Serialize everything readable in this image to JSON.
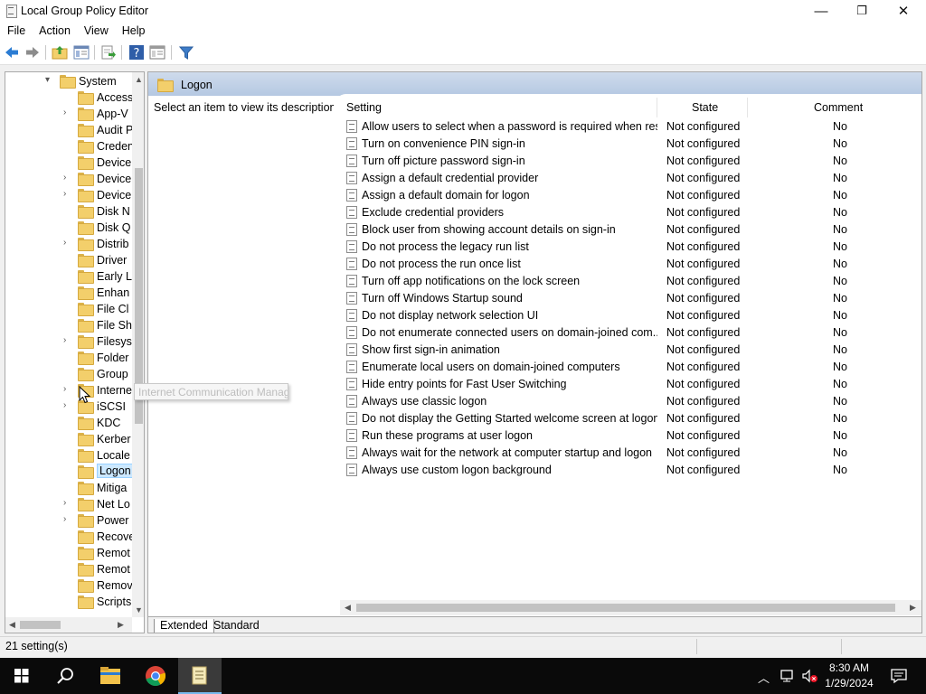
{
  "window": {
    "title": "Local Group Policy Editor",
    "minimize_glyph": "—",
    "restore_glyph": "❐",
    "close_glyph": "✕"
  },
  "menu": [
    "File",
    "Action",
    "View",
    "Help"
  ],
  "toolbar_icons": [
    "back-arrow-icon",
    "forward-arrow-icon",
    "up-folder-icon",
    "show-hide-tree-icon",
    "export-list-icon",
    "help-icon",
    "properties-icon",
    "filter-icon"
  ],
  "tree": {
    "items": [
      {
        "label": "System",
        "expander": "▾"
      },
      {
        "label": "Access",
        "expander": ""
      },
      {
        "label": "App-V",
        "expander": "›"
      },
      {
        "label": "Audit P",
        "expander": ""
      },
      {
        "label": "Creden",
        "expander": ""
      },
      {
        "label": "Device",
        "expander": ""
      },
      {
        "label": "Device",
        "expander": "›"
      },
      {
        "label": "Device",
        "expander": "›"
      },
      {
        "label": "Disk N",
        "expander": ""
      },
      {
        "label": "Disk Q",
        "expander": ""
      },
      {
        "label": "Distrib",
        "expander": "›"
      },
      {
        "label": "Driver",
        "expander": ""
      },
      {
        "label": "Early L",
        "expander": ""
      },
      {
        "label": "Enhan",
        "expander": ""
      },
      {
        "label": "File Cl",
        "expander": ""
      },
      {
        "label": "File Sh",
        "expander": ""
      },
      {
        "label": "Filesys",
        "expander": "›"
      },
      {
        "label": "Folder",
        "expander": ""
      },
      {
        "label": "Group",
        "expander": ""
      },
      {
        "label": "Interne",
        "expander": "›"
      },
      {
        "label": "iSCSI",
        "expander": "›"
      },
      {
        "label": "KDC",
        "expander": ""
      },
      {
        "label": "Kerber",
        "expander": ""
      },
      {
        "label": "Locale",
        "expander": ""
      },
      {
        "label": "Logon",
        "expander": ""
      },
      {
        "label": "Mitiga",
        "expander": ""
      },
      {
        "label": "Net Lo",
        "expander": "›"
      },
      {
        "label": "Power",
        "expander": "›"
      },
      {
        "label": "Recove",
        "expander": ""
      },
      {
        "label": "Remot",
        "expander": ""
      },
      {
        "label": "Remot",
        "expander": ""
      },
      {
        "label": "Remov",
        "expander": ""
      },
      {
        "label": "Scripts",
        "expander": ""
      }
    ],
    "selected_index": 24
  },
  "tooltip_ghost": "Internet Communication Management",
  "details": {
    "folder_title": "Logon",
    "description": "Select an item to view its description.",
    "columns": {
      "setting": "Setting",
      "state": "State",
      "comment": "Comment"
    },
    "rows": [
      {
        "setting": "Allow users to select when a password is required when resu...",
        "state": "Not configured",
        "comment": "No"
      },
      {
        "setting": "Turn on convenience PIN sign-in",
        "state": "Not configured",
        "comment": "No"
      },
      {
        "setting": "Turn off picture password sign-in",
        "state": "Not configured",
        "comment": "No"
      },
      {
        "setting": "Assign a default credential provider",
        "state": "Not configured",
        "comment": "No"
      },
      {
        "setting": "Assign a default domain for logon",
        "state": "Not configured",
        "comment": "No"
      },
      {
        "setting": "Exclude credential providers",
        "state": "Not configured",
        "comment": "No"
      },
      {
        "setting": "Block user from showing account details on sign-in",
        "state": "Not configured",
        "comment": "No"
      },
      {
        "setting": "Do not process the legacy run list",
        "state": "Not configured",
        "comment": "No"
      },
      {
        "setting": "Do not process the run once list",
        "state": "Not configured",
        "comment": "No"
      },
      {
        "setting": "Turn off app notifications on the lock screen",
        "state": "Not configured",
        "comment": "No"
      },
      {
        "setting": "Turn off Windows Startup sound",
        "state": "Not configured",
        "comment": "No"
      },
      {
        "setting": "Do not display network selection UI",
        "state": "Not configured",
        "comment": "No"
      },
      {
        "setting": "Do not enumerate connected users on domain-joined com...",
        "state": "Not configured",
        "comment": "No"
      },
      {
        "setting": "Show first sign-in animation",
        "state": "Not configured",
        "comment": "No"
      },
      {
        "setting": "Enumerate local users on domain-joined computers",
        "state": "Not configured",
        "comment": "No"
      },
      {
        "setting": "Hide entry points for Fast User Switching",
        "state": "Not configured",
        "comment": "No"
      },
      {
        "setting": "Always use classic logon",
        "state": "Not configured",
        "comment": "No"
      },
      {
        "setting": "Do not display the Getting Started welcome screen at logon",
        "state": "Not configured",
        "comment": "No"
      },
      {
        "setting": "Run these programs at user logon",
        "state": "Not configured",
        "comment": "No"
      },
      {
        "setting": "Always wait for the network at computer startup and logon",
        "state": "Not configured",
        "comment": "No"
      },
      {
        "setting": "Always use custom logon background",
        "state": "Not configured",
        "comment": "No"
      }
    ],
    "tabs": {
      "extended": "Extended",
      "standard": "Standard"
    }
  },
  "status": {
    "text": "21 setting(s)"
  },
  "taskbar": {
    "time": "8:30 AM",
    "date": "1/29/2024",
    "icons": [
      "windows-start-icon",
      "search-icon",
      "file-explorer-icon",
      "chrome-icon",
      "group-policy-editor-icon"
    ],
    "tray_icons": [
      "chevron-up-icon",
      "network-icon",
      "volume-muted-icon",
      "notifications-icon"
    ]
  },
  "colors": {
    "header_blue": "#b5c8e2",
    "selection": "#cce8ff",
    "folder": "#f3cf6b",
    "taskbar": "#0a0a0a"
  }
}
